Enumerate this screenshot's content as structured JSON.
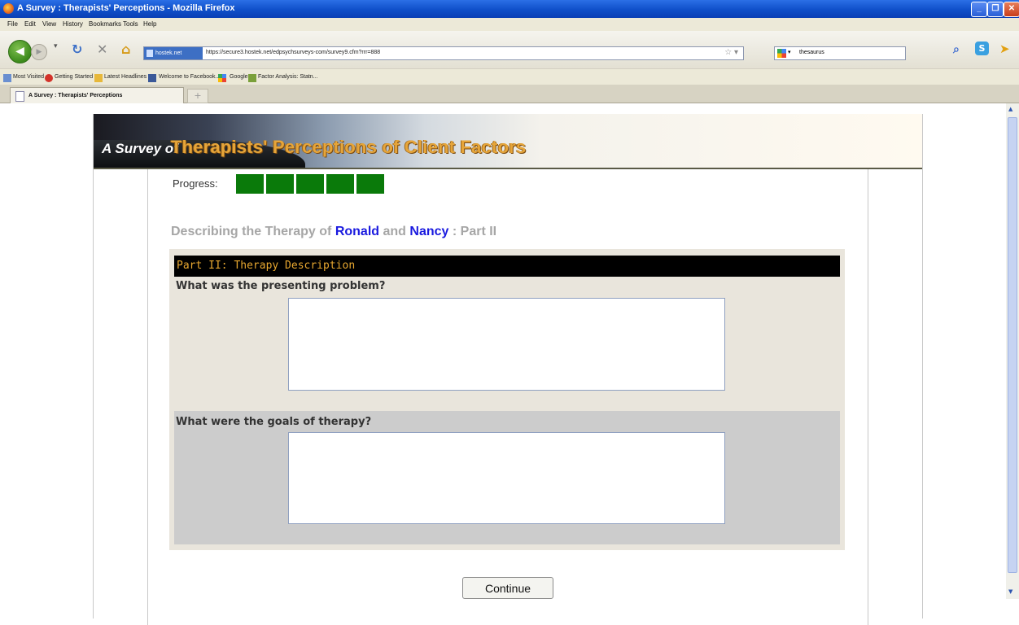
{
  "window": {
    "title": "A Survey : Therapists' Perceptions - Mozilla Firefox"
  },
  "menubar": [
    "File",
    "Edit",
    "View",
    "History",
    "Bookmarks",
    "Tools",
    "Help"
  ],
  "navbar": {
    "site_badge": "hostek.net",
    "url": "https://secure3.hostek.net/edpsychsurveys-com/survey9.cfm?rrr=888",
    "search_value": "thesaurus"
  },
  "bookmarks": [
    "Most Visited",
    "Getting Started",
    "Latest Headlines",
    "Welcome to Facebook...",
    "Google",
    "Factor Analysis: Statn..."
  ],
  "tab": {
    "label": "A Survey : Therapists' Perceptions",
    "new_tab": "+"
  },
  "page": {
    "banner": {
      "prefix": "A Survey of",
      "title": "Therapists' Perceptions of Client Factors"
    },
    "progress": {
      "label": "Progress:",
      "filled_blocks": 5,
      "block_color": "#0a7a0a"
    },
    "heading": {
      "prefix": "Describing the Therapy of",
      "name1": "Ronald",
      "conj": "and",
      "name2": "Nancy",
      "suffix": ": Part II"
    },
    "section_title": "Part II: Therapy Description",
    "questions": [
      {
        "label": "What was the presenting problem?",
        "value": ""
      },
      {
        "label": "What were the goals of therapy?",
        "value": ""
      }
    ],
    "continue_label": "Continue"
  },
  "colors": {
    "accent_orange": "#e8a830",
    "name_blue": "#1a1adf",
    "progress_green": "#0a7a0a"
  }
}
